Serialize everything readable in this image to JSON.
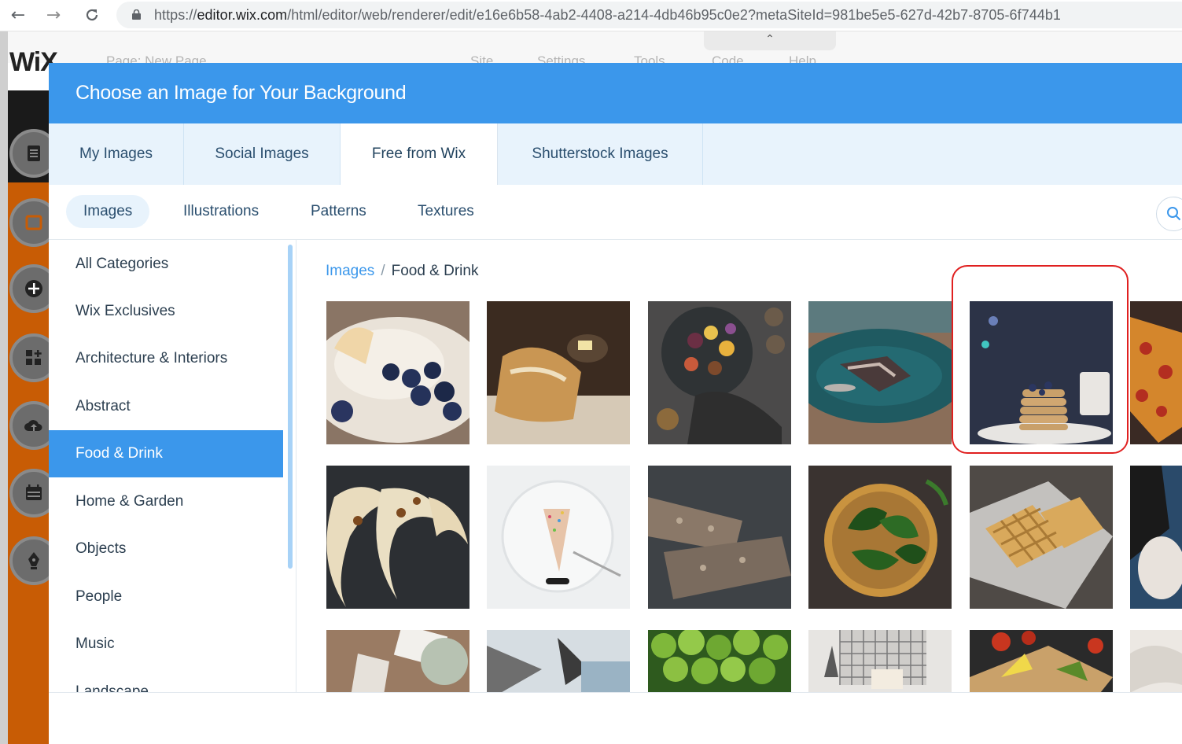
{
  "browser": {
    "url_scheme": "https://",
    "url_host": "editor.wix.com",
    "url_path": "/html/editor/web/renderer/edit/e16e6b58-4ab2-4408-a214-4db46b95c0e2?metaSiteId=981be5e5-627d-42b7-8705-6f744b1"
  },
  "editor": {
    "logo": "WiX",
    "faded_items": [
      "Page: New Page",
      "Site",
      "Settings",
      "Tools",
      "Code",
      "Help"
    ]
  },
  "dialog": {
    "title": "Choose an Image for Your Background",
    "tabs": [
      {
        "label": "My Images"
      },
      {
        "label": "Social Images"
      },
      {
        "label": "Free from Wix",
        "active": true
      },
      {
        "label": "Shutterstock Images"
      }
    ],
    "subtabs": [
      {
        "label": "Images",
        "active": true
      },
      {
        "label": "Illustrations"
      },
      {
        "label": "Patterns"
      },
      {
        "label": "Textures"
      }
    ],
    "categories": [
      {
        "label": "All Categories"
      },
      {
        "label": "Wix Exclusives"
      },
      {
        "label": "Architecture & Interiors"
      },
      {
        "label": "Abstract"
      },
      {
        "label": "Food & Drink",
        "active": true
      },
      {
        "label": "Home & Garden"
      },
      {
        "label": "Objects"
      },
      {
        "label": "People"
      },
      {
        "label": "Music"
      },
      {
        "label": "Landscape"
      }
    ],
    "breadcrumb": {
      "root": "Images",
      "separator": "/",
      "current": "Food & Drink"
    },
    "highlight_color": "#e02020",
    "accent_color": "#3b97eb"
  }
}
